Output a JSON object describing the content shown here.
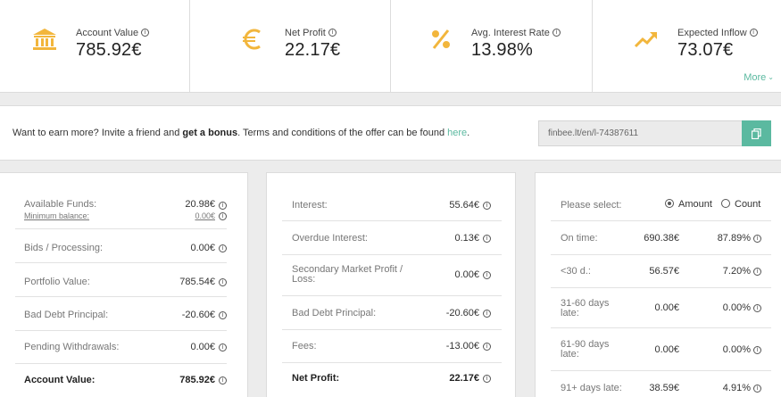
{
  "stats": [
    {
      "label": "Account Value",
      "value": "785.92€",
      "icon": "bank-icon"
    },
    {
      "label": "Net Profit",
      "value": "22.17€",
      "icon": "euro-icon"
    },
    {
      "label": "Avg. Interest Rate",
      "value": "13.98%",
      "icon": "percent-icon"
    },
    {
      "label": "Expected Inflow",
      "value": "73.07€",
      "icon": "trend-up-icon"
    }
  ],
  "more_label": "More",
  "accent_color": "#5bb9a0",
  "icon_color": "#f2b63c",
  "referral": {
    "text_prefix": "Want to earn more? Invite a friend and ",
    "text_bold": "get a bonus",
    "text_middle": ". Terms and conditions of the offer can be found ",
    "link_text": "here",
    "text_suffix": ".",
    "link_value": "finbee.lt/en/l-74387611"
  },
  "balance": {
    "available_funds_label": "Available Funds:",
    "available_funds_value": "20.98€",
    "minimum_balance_label": "Minimum balance:",
    "minimum_balance_value": "0.00€",
    "rows": [
      {
        "label": "Bids / Processing:",
        "value": "0.00€"
      },
      {
        "label": "Portfolio Value:",
        "value": "785.54€"
      },
      {
        "label": "Bad Debt Principal:",
        "value": "-20.60€"
      },
      {
        "label": "Pending Withdrawals:",
        "value": "0.00€"
      }
    ],
    "total_label": "Account Value:",
    "total_value": "785.92€"
  },
  "profit": {
    "rows": [
      {
        "label": "Interest:",
        "value": "55.64€"
      },
      {
        "label": "Overdue Interest:",
        "value": "0.13€"
      },
      {
        "label": "Secondary Market Profit /",
        "label2": "Loss:",
        "value": "0.00€"
      },
      {
        "label": "Bad Debt Principal:",
        "value": "-20.60€"
      },
      {
        "label": "Fees:",
        "value": "-13.00€"
      }
    ],
    "total_label": "Net Profit:",
    "total_value": "22.17€"
  },
  "portfolio": {
    "select_label": "Please select:",
    "option_amount": "Amount",
    "option_count": "Count",
    "selected": "Amount",
    "rows": [
      {
        "label": "On time:",
        "amount": "690.38€",
        "percent": "87.89%"
      },
      {
        "label": "<30 d.:",
        "amount": "56.57€",
        "percent": "7.20%"
      },
      {
        "label": "31-60 days",
        "label2": "late:",
        "amount": "0.00€",
        "percent": "0.00%"
      },
      {
        "label": "61-90 days",
        "label2": "late:",
        "amount": "0.00€",
        "percent": "0.00%"
      },
      {
        "label": "91+ days late:",
        "amount": "38.59€",
        "percent": "4.91%"
      }
    ]
  }
}
